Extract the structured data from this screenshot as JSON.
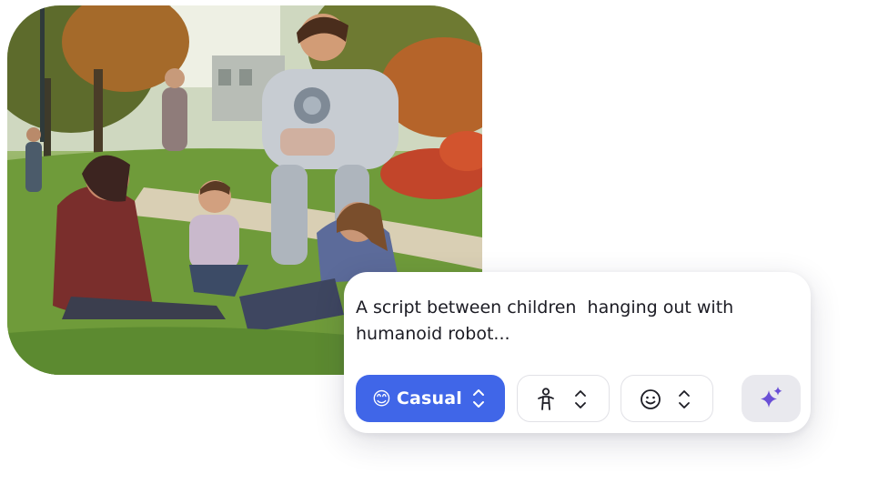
{
  "image": {
    "alt_subject": "illustration"
  },
  "prompt": {
    "text": "A script between children  hanging out with\nhumanoid robot..."
  },
  "toolbar": {
    "tone": {
      "emoji": "😊",
      "label": "Casual",
      "icon": "chevron-up-down-icon"
    },
    "character": {
      "icon": "person-icon",
      "chevron": "chevron-up-down-icon"
    },
    "mood": {
      "icon": "smiley-icon",
      "chevron": "chevron-up-down-icon"
    },
    "generate": {
      "icon": "sparkles-icon"
    }
  },
  "colors": {
    "accent": "#4066e8",
    "generate_bg": "#e9e9ee",
    "sparkle": "#6a4fd6",
    "text": "#1c1c24"
  }
}
